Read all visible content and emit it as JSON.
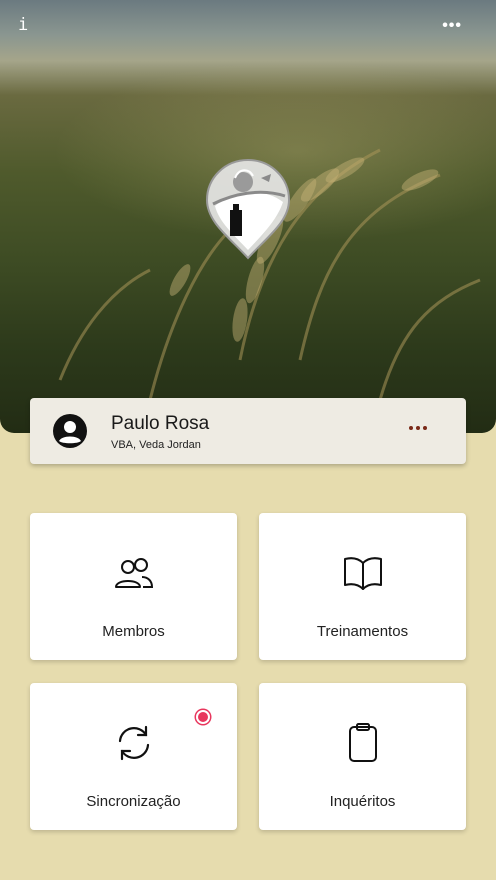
{
  "header": {
    "info_icon": "i",
    "more_icon": "•••"
  },
  "profile": {
    "name": "Paulo Rosa",
    "subtitle": "VBA, Veda Jordan"
  },
  "tiles": [
    {
      "label": "Membros",
      "icon": "people-icon"
    },
    {
      "label": "Treinamentos",
      "icon": "book-icon"
    },
    {
      "label": "Sincronização",
      "icon": "sync-icon",
      "badge": true
    },
    {
      "label": "Inquéritos",
      "icon": "clipboard-icon"
    }
  ],
  "colors": {
    "background": "#e6dcae",
    "card": "#eeebe3",
    "tile": "#ffffff",
    "badge": "#e8365d",
    "more_dots": "#7a2a18"
  }
}
